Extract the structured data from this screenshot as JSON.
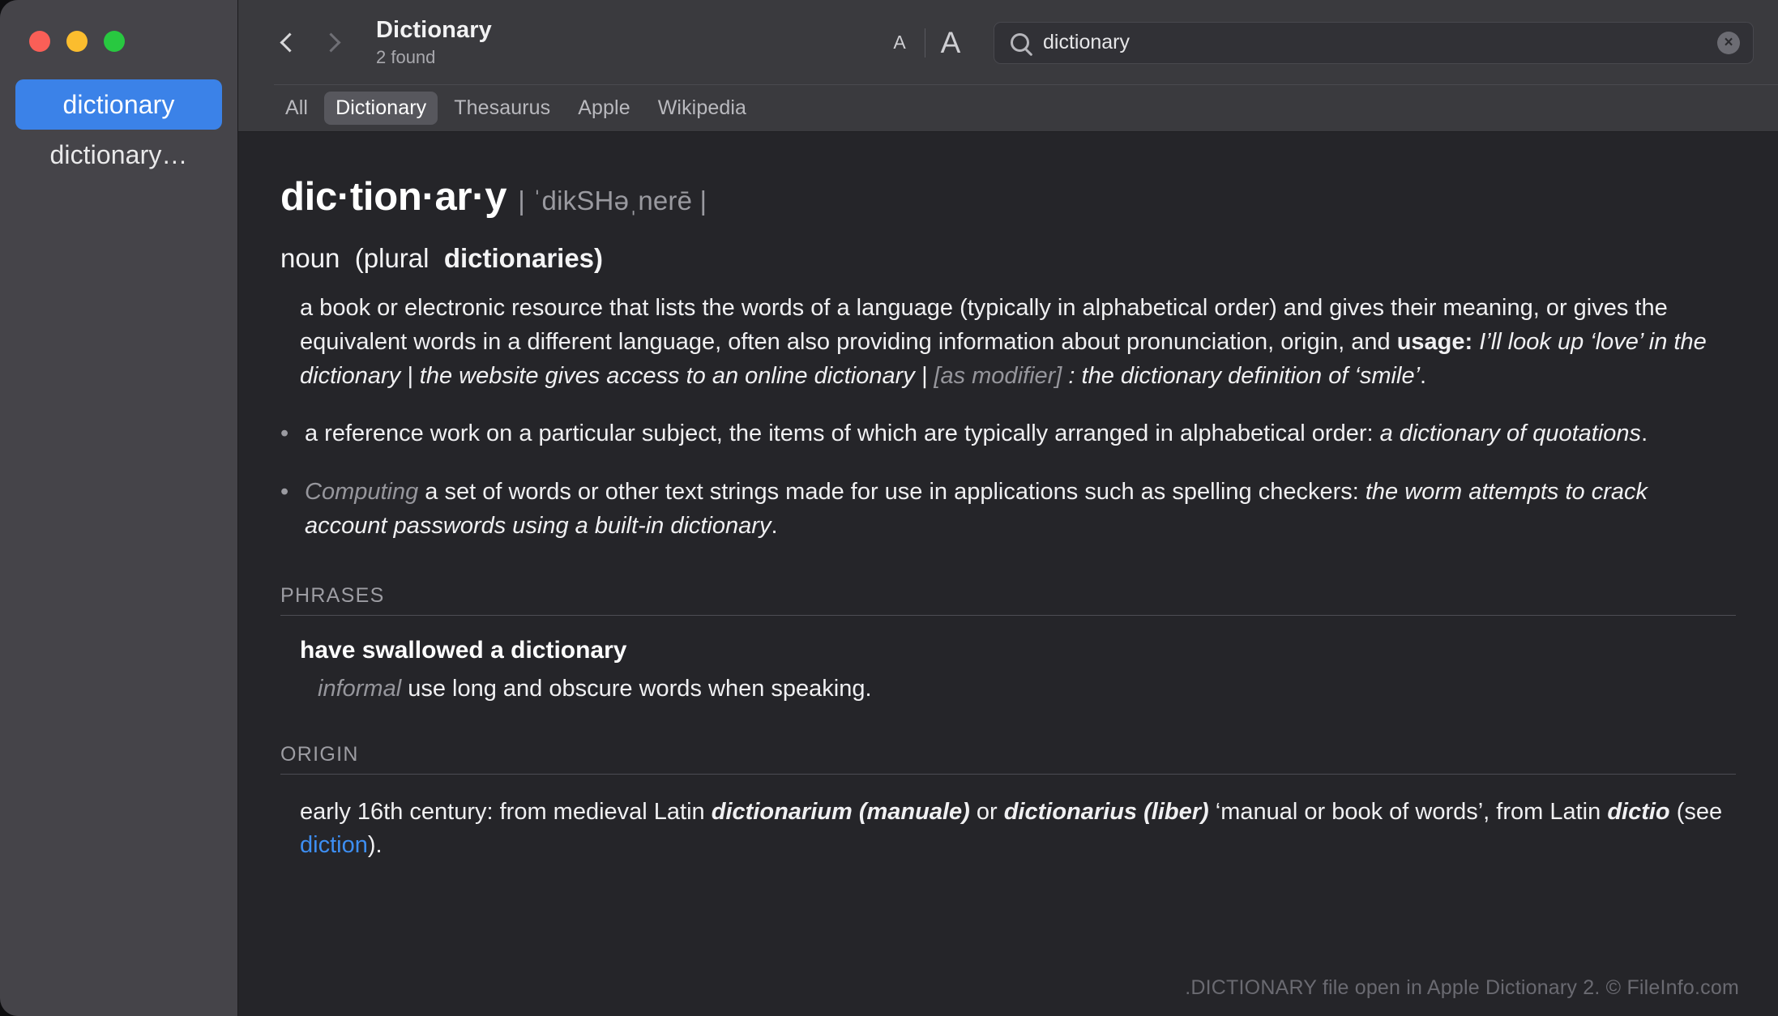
{
  "window": {
    "traffic_lights": [
      {
        "name": "close",
        "color": "#fa5f57"
      },
      {
        "name": "minimize",
        "color": "#fbbd2e"
      },
      {
        "name": "zoom",
        "color": "#28c840"
      }
    ]
  },
  "sidebar": {
    "items": [
      {
        "label": "dictionary",
        "selected": true
      },
      {
        "label": "dictionary…",
        "selected": false
      }
    ]
  },
  "toolbar": {
    "back_icon": "chevron-left-icon",
    "forward_icon": "chevron-right-icon",
    "title": "Dictionary",
    "subtitle": "2 found",
    "font_smaller_label": "A",
    "font_larger_label": "A",
    "search": {
      "icon": "search-icon",
      "value": "dictionary",
      "placeholder": "Search",
      "clear_label": "×"
    }
  },
  "tabs": [
    {
      "label": "All",
      "active": false
    },
    {
      "label": "Dictionary",
      "active": true
    },
    {
      "label": "Thesaurus",
      "active": false
    },
    {
      "label": "Apple",
      "active": false
    },
    {
      "label": "Wikipedia",
      "active": false
    }
  ],
  "entry": {
    "headword": "dic·tion·ar·y",
    "pronunciation": "| ˈdikSHəˌnerē |",
    "part_of_speech": "noun",
    "inflection_open": "(plural",
    "inflection_word": "dictionaries)",
    "sense_1": {
      "text": "a book or electronic resource that lists the words of a language (typically in alphabetical order) and gives their meaning, or gives the equivalent words in a different language, often also providing information about pronunciation, origin, and ",
      "usage_label": "usage:",
      "example_1": " I’ll look up ‘love’ in the dictionary",
      "separator_1": " | ",
      "example_2": "the website gives access to an online dictionary",
      "separator_2": " | ",
      "modifier_label": "[as modifier]",
      "example_3": " : the dictionary definition of ‘smile’",
      "period": "."
    },
    "subsenses": [
      {
        "bullet": "•",
        "text": "a reference work on a particular subject, the items of which are typically arranged in alphabetical order: ",
        "example": "a dictionary of quotations",
        "period": "."
      },
      {
        "bullet": "•",
        "domain_label": "Computing",
        "text": " a set of words or other text strings made for use in applications such as spelling checkers: ",
        "example": "the worm attempts to crack account passwords using a built-in dictionary",
        "period": "."
      }
    ],
    "phrases": {
      "heading": "PHRASES",
      "term": "have swallowed a dictionary",
      "register": "informal",
      "definition": " use long and obscure words when speaking."
    },
    "origin": {
      "heading": "ORIGIN",
      "part_1": "early 16th century: from medieval Latin ",
      "latin_1": "dictionarium (manuale)",
      "part_2": " or ",
      "latin_2": "dictionarius (liber)",
      "part_3": " ‘manual or book of words’, from Latin ",
      "latin_3": "dictio",
      "part_4": " (see ",
      "link_text": "diction",
      "part_5": ")."
    }
  },
  "watermark": ".DICTIONARY file open in Apple Dictionary 2. © FileInfo.com",
  "colors": {
    "accent_blue": "#3b82e8",
    "link_blue": "#3d8ef2",
    "sidebar_bg": "#454449",
    "content_bg": "#252529",
    "toolbar_bg": "#3a3a3e"
  }
}
